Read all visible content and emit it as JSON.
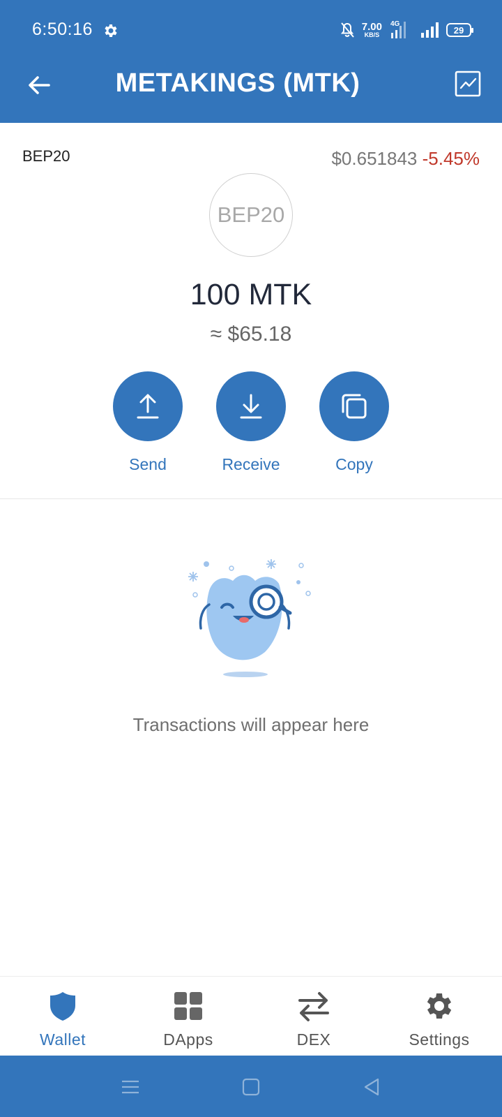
{
  "status_bar": {
    "time": "6:50:16",
    "speed_value": "7.00",
    "speed_unit": "KB/S",
    "network_type": "4G",
    "battery": "29"
  },
  "header": {
    "title": "METAKINGS (MTK)",
    "back_icon": "arrow-left-icon",
    "chart_icon": "line-chart-icon"
  },
  "token": {
    "network": "BEP20",
    "price": "$0.651843",
    "change": "-5.45%",
    "logo_text": "BEP20",
    "balance": "100 MTK",
    "fiat_value": "≈ $65.18"
  },
  "actions": [
    {
      "label": "Send",
      "icon": "upload-arrow-icon"
    },
    {
      "label": "Receive",
      "icon": "download-arrow-icon"
    },
    {
      "label": "Copy",
      "icon": "copy-icon"
    }
  ],
  "transactions": {
    "empty_message": "Transactions will appear here"
  },
  "tabs": [
    {
      "label": "Wallet",
      "icon": "shield-icon",
      "active": true
    },
    {
      "label": "DApps",
      "icon": "grid-icon",
      "active": false
    },
    {
      "label": "DEX",
      "icon": "swap-arrows-icon",
      "active": false
    },
    {
      "label": "Settings",
      "icon": "gear-icon",
      "active": false
    }
  ],
  "colors": {
    "brand": "#3375bb",
    "negative": "#c0392b"
  }
}
